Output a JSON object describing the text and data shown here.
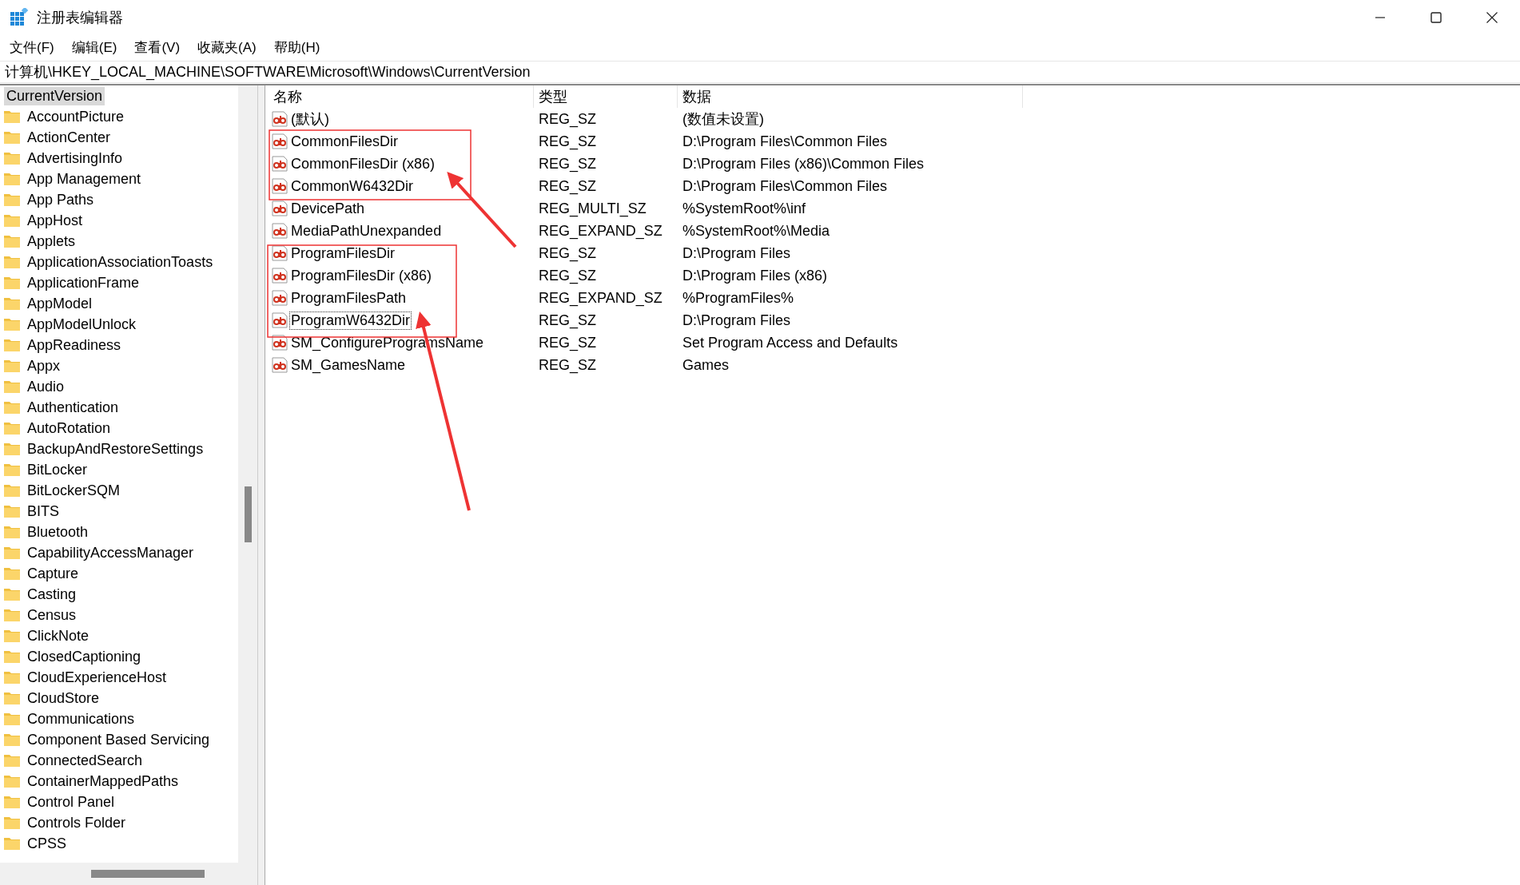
{
  "window": {
    "title": "注册表编辑器"
  },
  "menu": [
    "文件(F)",
    "编辑(E)",
    "查看(V)",
    "收藏夹(A)",
    "帮助(H)"
  ],
  "address": "计算机\\HKEY_LOCAL_MACHINE\\SOFTWARE\\Microsoft\\Windows\\CurrentVersion",
  "tree": {
    "root": {
      "label": "CurrentVersion",
      "selected": true
    },
    "children": [
      {
        "label": "AccountPicture"
      },
      {
        "label": "ActionCenter"
      },
      {
        "label": "AdvertisingInfo"
      },
      {
        "label": "App Management"
      },
      {
        "label": "App Paths"
      },
      {
        "label": "AppHost"
      },
      {
        "label": "Applets"
      },
      {
        "label": "ApplicationAssociationToasts"
      },
      {
        "label": "ApplicationFrame"
      },
      {
        "label": "AppModel"
      },
      {
        "label": "AppModelUnlock"
      },
      {
        "label": "AppReadiness"
      },
      {
        "label": "Appx"
      },
      {
        "label": "Audio"
      },
      {
        "label": "Authentication"
      },
      {
        "label": "AutoRotation"
      },
      {
        "label": "BackupAndRestoreSettings"
      },
      {
        "label": "BitLocker"
      },
      {
        "label": "BitLockerSQM"
      },
      {
        "label": "BITS"
      },
      {
        "label": "Bluetooth"
      },
      {
        "label": "CapabilityAccessManager"
      },
      {
        "label": "Capture"
      },
      {
        "label": "Casting"
      },
      {
        "label": "Census"
      },
      {
        "label": "ClickNote"
      },
      {
        "label": "ClosedCaptioning"
      },
      {
        "label": "CloudExperienceHost"
      },
      {
        "label": "CloudStore"
      },
      {
        "label": "Communications"
      },
      {
        "label": "Component Based Servicing"
      },
      {
        "label": "ConnectedSearch"
      },
      {
        "label": "ContainerMappedPaths"
      },
      {
        "label": "Control Panel"
      },
      {
        "label": "Controls Folder"
      },
      {
        "label": "CPSS"
      }
    ]
  },
  "table": {
    "columns": [
      "名称",
      "类型",
      "数据"
    ],
    "rows": [
      {
        "name": "(默认)",
        "type": "REG_SZ",
        "data": "(数值未设置)",
        "focused": false
      },
      {
        "name": "CommonFilesDir",
        "type": "REG_SZ",
        "data": "D:\\Program Files\\Common Files",
        "focused": false
      },
      {
        "name": "CommonFilesDir (x86)",
        "type": "REG_SZ",
        "data": "D:\\Program Files (x86)\\Common Files",
        "focused": false
      },
      {
        "name": "CommonW6432Dir",
        "type": "REG_SZ",
        "data": "D:\\Program Files\\Common Files",
        "focused": false
      },
      {
        "name": "DevicePath",
        "type": "REG_MULTI_SZ",
        "data": "%SystemRoot%\\inf",
        "focused": false
      },
      {
        "name": "MediaPathUnexpanded",
        "type": "REG_EXPAND_SZ",
        "data": "%SystemRoot%\\Media",
        "focused": false
      },
      {
        "name": "ProgramFilesDir",
        "type": "REG_SZ",
        "data": "D:\\Program Files",
        "focused": false
      },
      {
        "name": "ProgramFilesDir (x86)",
        "type": "REG_SZ",
        "data": "D:\\Program Files (x86)",
        "focused": false
      },
      {
        "name": "ProgramFilesPath",
        "type": "REG_EXPAND_SZ",
        "data": "%ProgramFiles%",
        "focused": false
      },
      {
        "name": "ProgramW6432Dir",
        "type": "REG_SZ",
        "data": "D:\\Program Files",
        "focused": true
      },
      {
        "name": "SM_ConfigureProgramsName",
        "type": "REG_SZ",
        "data": "Set Program Access and Defaults",
        "focused": false
      },
      {
        "name": "SM_GamesName",
        "type": "REG_SZ",
        "data": "Games",
        "focused": false
      }
    ]
  }
}
